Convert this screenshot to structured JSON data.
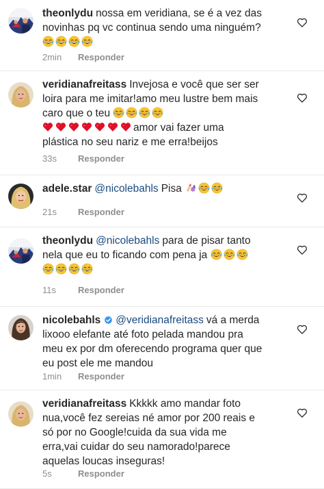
{
  "comments": [
    {
      "username": "theonlydu",
      "avatar": "crowd-photo",
      "lines": [
        {
          "parts": [
            {
              "t": "username",
              "v": "theonlydu"
            },
            {
              "t": "text",
              "v": "nossa em veridiana, se é a vez das"
            }
          ]
        },
        {
          "parts": [
            {
              "t": "text",
              "v": "novinhas pq vc continua sendo uma ninguém?"
            }
          ]
        },
        {
          "parts": [
            {
              "t": "laugh",
              "n": 4
            }
          ]
        }
      ],
      "time": "2min",
      "reply_label": "Responder"
    },
    {
      "username": "veridianafreitass",
      "avatar": "blonde-woman",
      "lines": [
        {
          "parts": [
            {
              "t": "username",
              "v": "veridianafreitass"
            },
            {
              "t": "text",
              "v": "Invejosa e você que ser ser"
            }
          ]
        },
        {
          "parts": [
            {
              "t": "text",
              "v": "loira para me imitar!amo meu lustre bem mais"
            }
          ]
        },
        {
          "parts": [
            {
              "t": "text",
              "v": "caro que o teu"
            },
            {
              "t": "laugh",
              "n": 4
            }
          ]
        },
        {
          "parts": [
            {
              "t": "hearts",
              "n": 7
            },
            {
              "t": "text",
              "v": "amor vai fazer uma"
            }
          ]
        },
        {
          "parts": [
            {
              "t": "text",
              "v": "plástica no seu nariz e me erra!beijos"
            }
          ]
        }
      ],
      "time": "33s",
      "reply_label": "Responder"
    },
    {
      "username": "adele.star",
      "avatar": "blonde-star",
      "lines": [
        {
          "parts": [
            {
              "t": "username",
              "v": "adele.star"
            },
            {
              "t": "mention",
              "v": "@nicolebahls"
            },
            {
              "t": "text",
              "v": "Pisa"
            },
            {
              "t": "nail",
              "n": 1
            },
            {
              "t": "laugh",
              "n": 2
            }
          ]
        }
      ],
      "time": "21s",
      "reply_label": "Responder"
    },
    {
      "username": "theonlydu",
      "avatar": "crowd-photo",
      "lines": [
        {
          "parts": [
            {
              "t": "username",
              "v": "theonlydu"
            },
            {
              "t": "mention",
              "v": "@nicolebahls"
            },
            {
              "t": "text",
              "v": "para de pisar tanto"
            }
          ]
        },
        {
          "parts": [
            {
              "t": "text",
              "v": "nela que eu to ficando com pena ja"
            },
            {
              "t": "laugh",
              "n": 3
            }
          ]
        },
        {
          "parts": [
            {
              "t": "laugh",
              "n": 4
            }
          ]
        }
      ],
      "time": "11s",
      "reply_label": "Responder"
    },
    {
      "username": "nicolebahls",
      "avatar": "brunette-woman",
      "verified": true,
      "lines": [
        {
          "parts": [
            {
              "t": "username",
              "v": "nicolebahls"
            },
            {
              "t": "verified"
            },
            {
              "t": "mention",
              "v": "@veridianafreitass"
            },
            {
              "t": "text",
              "v": "vá a merda"
            }
          ]
        },
        {
          "parts": [
            {
              "t": "text",
              "v": "lixooo elefante até foto pelada mandou pra"
            }
          ]
        },
        {
          "parts": [
            {
              "t": "text",
              "v": "meu ex por dm oferecendo programa quer que"
            }
          ]
        },
        {
          "parts": [
            {
              "t": "text",
              "v": "eu post ele me mandou"
            }
          ]
        }
      ],
      "time": "1min",
      "reply_label": "Responder"
    },
    {
      "username": "veridianafreitass",
      "avatar": "blonde-woman",
      "lines": [
        {
          "parts": [
            {
              "t": "username",
              "v": "veridianafreitass"
            },
            {
              "t": "text",
              "v": "Kkkkk amo mandar foto"
            }
          ]
        },
        {
          "parts": [
            {
              "t": "text",
              "v": "nua,você fez sereias né amor por 200 reais e"
            }
          ]
        },
        {
          "parts": [
            {
              "t": "text",
              "v": "só por no Google!cuida da sua vida me"
            }
          ]
        },
        {
          "parts": [
            {
              "t": "text",
              "v": "erra,vai cuidar do seu namorado!parece"
            }
          ]
        },
        {
          "parts": [
            {
              "t": "text",
              "v": "aquelas loucas inseguras!"
            }
          ]
        }
      ],
      "time": "5s",
      "reply_label": "Responder"
    }
  ],
  "colors": {
    "text": "#262626",
    "meta": "#8e8e8e",
    "mention": "#1a4a80",
    "verified": "#3897f0",
    "divider": "#e9e9e9",
    "heart_emoji": "#e0102a"
  },
  "icons": {
    "like": "heart-outline-icon",
    "laugh": "face-with-tears-of-joy-emoji",
    "love": "red-heart-emoji",
    "nails": "nail-polish-emoji",
    "verified": "verified-badge-icon"
  }
}
